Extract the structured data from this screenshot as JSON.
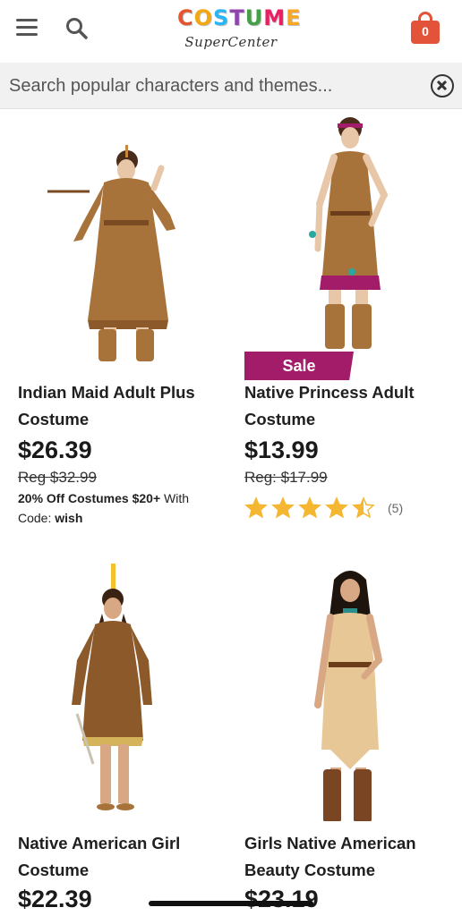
{
  "header": {
    "menu_icon": "hamburger-menu-icon",
    "search_icon": "search-icon",
    "logo": {
      "top": "COSTUME",
      "bottom": "SuperCenter",
      "letter_colors": [
        "#e4572e",
        "#f3a712",
        "#29b6f6",
        "#8e44ad",
        "#43a047",
        "#e91e63",
        "#f9a825"
      ]
    },
    "cart_count": "0",
    "cart_color": "#e2533a"
  },
  "search": {
    "placeholder": "Search popular characters and themes..."
  },
  "products": [
    {
      "title_line1": "Indian Maid Adult Plus",
      "title_line2": "Costume",
      "price": "$26.39",
      "reg_price": "Reg $32.99",
      "promo_bold": "20% Off Costumes $20+",
      "promo_rest": " With",
      "promo_code_prefix": "Code: ",
      "promo_code": "wish"
    },
    {
      "badge": "Sale",
      "title_line1": "Native Princess Adult",
      "title_line2": "Costume",
      "price": "$13.99",
      "reg_price": "Reg: $17.99",
      "rating": 4.5,
      "rating_count": "(5)"
    },
    {
      "title_line1": "Native American Girl",
      "title_line2": "Costume",
      "price": "$22.39"
    },
    {
      "title_line1": "Girls Native American",
      "title_line2": "Beauty Costume",
      "price": "$23.19"
    }
  ],
  "colors": {
    "sale": "#a21c6a",
    "star": "#f5b731",
    "costume_brown": "#a8733a"
  }
}
